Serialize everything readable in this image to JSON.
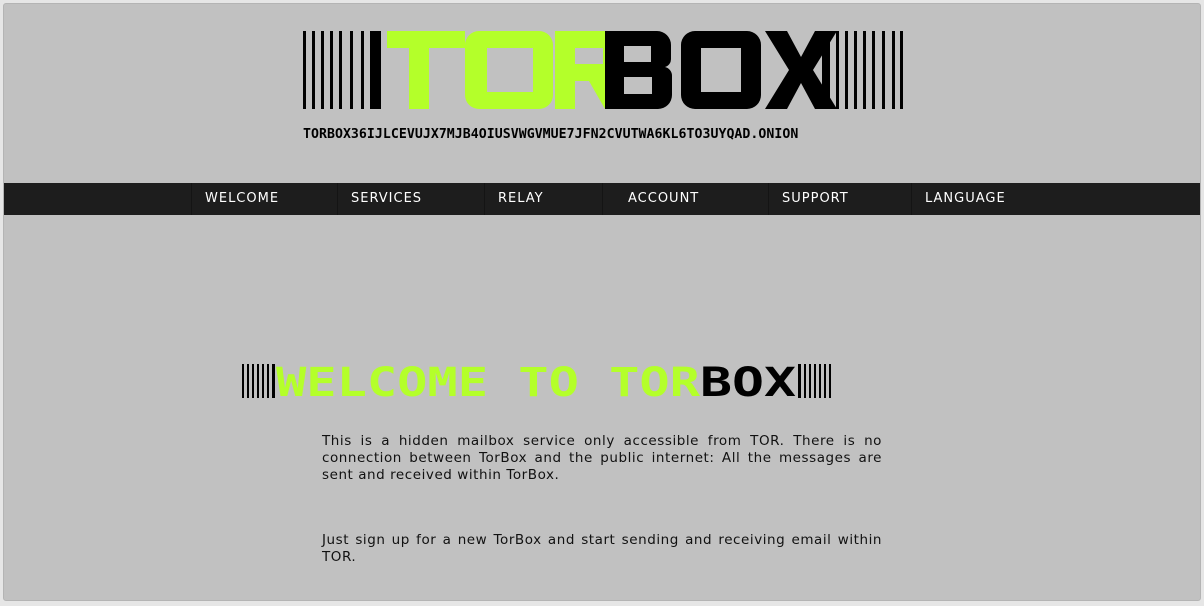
{
  "colors": {
    "page_bg": "#c1c1c1",
    "nav_bg": "#1d1d1d",
    "accent_green": "#b4ff2a",
    "text_dark": "#000000",
    "nav_text": "#ffffff"
  },
  "header": {
    "logo_part_accent": "TOR",
    "logo_part_dark": "BOX",
    "onion_address": "TORBOX36IJLCEVUJX7MJB4OIUSVWGVMUE7JFN2CVUTWA6KL6TO3UYQAD.ONION"
  },
  "nav": {
    "items": [
      {
        "label": "WELCOME"
      },
      {
        "label": "SERVICES"
      },
      {
        "label": "RELAY"
      },
      {
        "label": "ACCOUNT"
      },
      {
        "label": "SUPPORT"
      },
      {
        "label": "LANGUAGE"
      }
    ]
  },
  "main": {
    "heading_accent": "WELCOME TO TOR",
    "heading_dark": "BOX",
    "paragraphs": [
      "This is a hidden mailbox service only accessible from TOR. There is no connection between TorBox and the public internet: All the messages are sent and received within TorBox.",
      "Just sign up for a new TorBox and start sending and receiving email within TOR."
    ]
  }
}
